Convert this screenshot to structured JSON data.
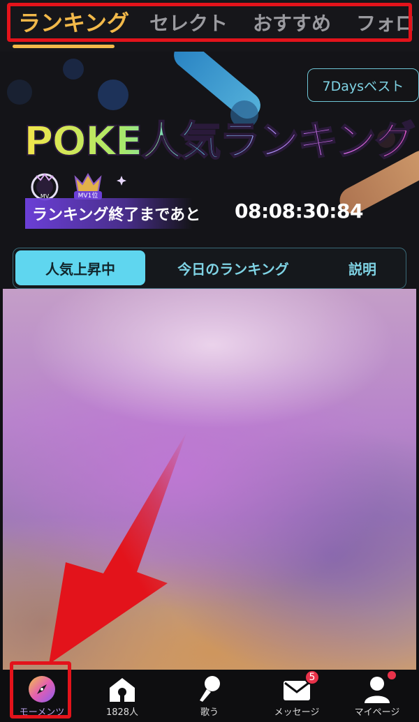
{
  "top_tabs": [
    {
      "label": "ランキング",
      "active": true
    },
    {
      "label": "セレクト",
      "active": false
    },
    {
      "label": "おすすめ",
      "active": false
    },
    {
      "label": "フォロ",
      "active": false
    }
  ],
  "banner": {
    "period_button": "7Daysベスト",
    "title_art": "POKE人気ランキング",
    "badge_left_text": "MV",
    "badge_right_text": "MV1位",
    "countdown_label": "ランキング終了まであと",
    "countdown_time": "08:08:30:84"
  },
  "segments": [
    {
      "label": "人気上昇中",
      "active": true
    },
    {
      "label": "今日のランキング",
      "active": false
    },
    {
      "label": "説明",
      "active": false
    }
  ],
  "bottom_nav": [
    {
      "label": "モーメンツ",
      "icon": "compass-icon",
      "active": true
    },
    {
      "label": "1828人",
      "icon": "house-icon",
      "active": false
    },
    {
      "label": "歌う",
      "icon": "microphone-icon",
      "active": false
    },
    {
      "label": "メッセージ",
      "icon": "mail-icon",
      "active": false,
      "badge": "5"
    },
    {
      "label": "マイページ",
      "icon": "user-icon",
      "active": false,
      "dot": true
    }
  ],
  "colors": {
    "accent_orange": "#f2b94a",
    "accent_cyan": "#5fd6ef",
    "annotation_red": "#e3131b",
    "badge_red": "#e8324a"
  }
}
